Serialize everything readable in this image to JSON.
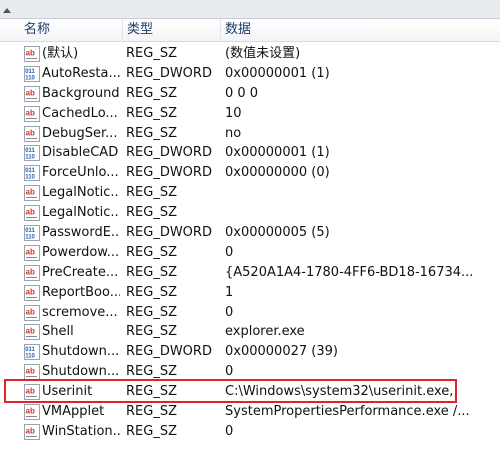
{
  "columns": {
    "name": "名称",
    "type": "类型",
    "data": "数据"
  },
  "rows": [
    {
      "icon": "string-value-icon",
      "name": "(默认)",
      "type": "REG_SZ",
      "data": "(数值未设置)"
    },
    {
      "icon": "dword-value-icon",
      "name": "AutoResta...",
      "type": "REG_DWORD",
      "data": "0x00000001 (1)"
    },
    {
      "icon": "string-value-icon",
      "name": "Background",
      "type": "REG_SZ",
      "data": "0 0 0"
    },
    {
      "icon": "string-value-icon",
      "name": "CachedLo...",
      "type": "REG_SZ",
      "data": "10"
    },
    {
      "icon": "string-value-icon",
      "name": "DebugSer...",
      "type": "REG_SZ",
      "data": "no"
    },
    {
      "icon": "dword-value-icon",
      "name": "DisableCAD",
      "type": "REG_DWORD",
      "data": "0x00000001 (1)"
    },
    {
      "icon": "dword-value-icon",
      "name": "ForceUnlo...",
      "type": "REG_DWORD",
      "data": "0x00000000 (0)"
    },
    {
      "icon": "string-value-icon",
      "name": "LegalNotic...",
      "type": "REG_SZ",
      "data": ""
    },
    {
      "icon": "string-value-icon",
      "name": "LegalNotic...",
      "type": "REG_SZ",
      "data": ""
    },
    {
      "icon": "dword-value-icon",
      "name": "PasswordE...",
      "type": "REG_DWORD",
      "data": "0x00000005 (5)"
    },
    {
      "icon": "string-value-icon",
      "name": "Powerdow...",
      "type": "REG_SZ",
      "data": "0"
    },
    {
      "icon": "string-value-icon",
      "name": "PreCreate...",
      "type": "REG_SZ",
      "data": "{A520A1A4-1780-4FF6-BD18-16734..."
    },
    {
      "icon": "string-value-icon",
      "name": "ReportBoo...",
      "type": "REG_SZ",
      "data": "1"
    },
    {
      "icon": "string-value-icon",
      "name": "scremove...",
      "type": "REG_SZ",
      "data": "0"
    },
    {
      "icon": "string-value-icon",
      "name": "Shell",
      "type": "REG_SZ",
      "data": "explorer.exe"
    },
    {
      "icon": "dword-value-icon",
      "name": "Shutdown...",
      "type": "REG_DWORD",
      "data": "0x00000027 (39)"
    },
    {
      "icon": "string-value-icon",
      "name": "Shutdown...",
      "type": "REG_SZ",
      "data": "0"
    },
    {
      "icon": "string-value-icon",
      "name": "Userinit",
      "type": "REG_SZ",
      "data": "C:\\Windows\\system32\\userinit.exe,"
    },
    {
      "icon": "string-value-icon",
      "name": "VMApplet",
      "type": "REG_SZ",
      "data": "SystemPropertiesPerformance.exe /..."
    },
    {
      "icon": "string-value-icon",
      "name": "WinStation...",
      "type": "REG_SZ",
      "data": "0"
    }
  ],
  "highlighted_row": "Userinit",
  "colors": {
    "highlight": "#e0232a",
    "header_text": "#1f3d68",
    "string_icon": "#c8372d",
    "dword_icon": "#2a5fb0"
  }
}
